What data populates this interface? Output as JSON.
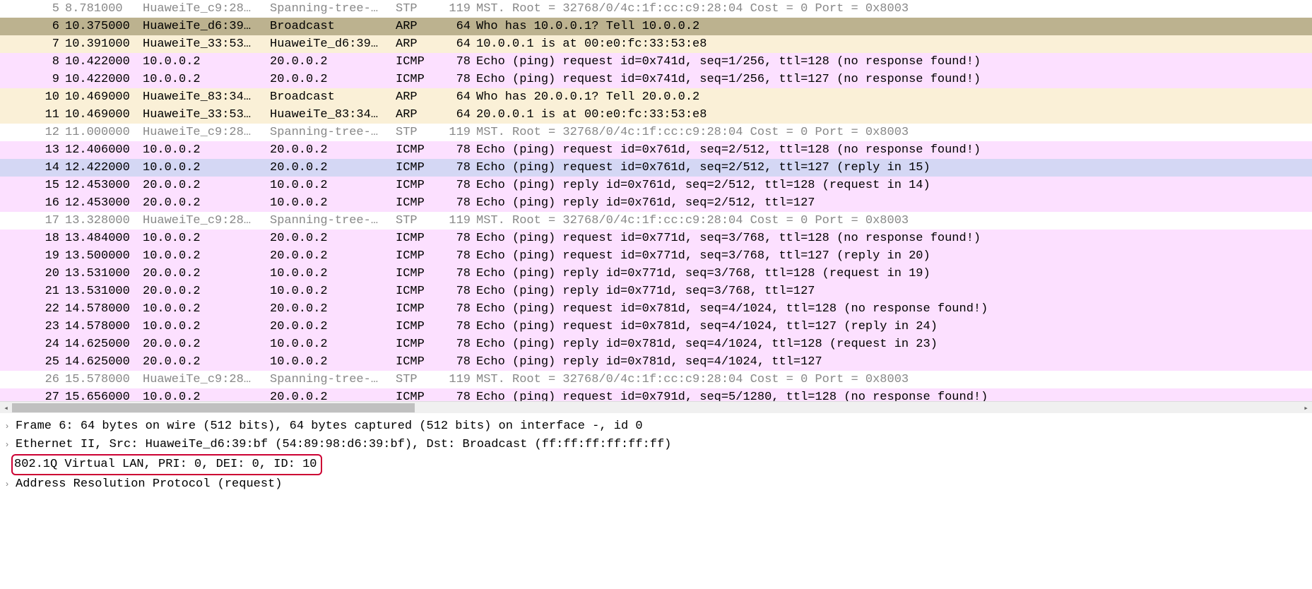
{
  "packets": [
    {
      "no": "5",
      "time": "8.781000",
      "src": "HuaweiTe_c9:28…",
      "dst": "Spanning-tree-…",
      "proto": "STP",
      "len": "119",
      "info": "MST. Root = 32768/0/4c:1f:cc:c9:28:04  Cost = 0  Port = 0x8003",
      "cls": "c-gray"
    },
    {
      "no": "6",
      "time": "10.375000",
      "src": "HuaweiTe_d6:39…",
      "dst": "Broadcast",
      "proto": "ARP",
      "len": "64",
      "info": "Who has 10.0.0.1? Tell 10.0.0.2",
      "cls": "c-selected"
    },
    {
      "no": "7",
      "time": "10.391000",
      "src": "HuaweiTe_33:53…",
      "dst": "HuaweiTe_d6:39…",
      "proto": "ARP",
      "len": "64",
      "info": "10.0.0.1 is at 00:e0:fc:33:53:e8",
      "cls": "c-arp"
    },
    {
      "no": "8",
      "time": "10.422000",
      "src": "10.0.0.2",
      "dst": "20.0.0.2",
      "proto": "ICMP",
      "len": "78",
      "info": "Echo (ping) request  id=0x741d, seq=1/256, ttl=128 (no response found!)",
      "cls": "c-icmp"
    },
    {
      "no": "9",
      "time": "10.422000",
      "src": "10.0.0.2",
      "dst": "20.0.0.2",
      "proto": "ICMP",
      "len": "78",
      "info": "Echo (ping) request  id=0x741d, seq=1/256, ttl=127 (no response found!)",
      "cls": "c-icmp"
    },
    {
      "no": "10",
      "time": "10.469000",
      "src": "HuaweiTe_83:34…",
      "dst": "Broadcast",
      "proto": "ARP",
      "len": "64",
      "info": "Who has 20.0.0.1? Tell 20.0.0.2",
      "cls": "c-arp"
    },
    {
      "no": "11",
      "time": "10.469000",
      "src": "HuaweiTe_33:53…",
      "dst": "HuaweiTe_83:34…",
      "proto": "ARP",
      "len": "64",
      "info": "20.0.0.1 is at 00:e0:fc:33:53:e8",
      "cls": "c-arp"
    },
    {
      "no": "12",
      "time": "11.000000",
      "src": "HuaweiTe_c9:28…",
      "dst": "Spanning-tree-…",
      "proto": "STP",
      "len": "119",
      "info": "MST. Root = 32768/0/4c:1f:cc:c9:28:04  Cost = 0  Port = 0x8003",
      "cls": "c-gray"
    },
    {
      "no": "13",
      "time": "12.406000",
      "src": "10.0.0.2",
      "dst": "20.0.0.2",
      "proto": "ICMP",
      "len": "78",
      "info": "Echo (ping) request  id=0x761d, seq=2/512, ttl=128 (no response found!)",
      "cls": "c-icmp"
    },
    {
      "no": "14",
      "time": "12.422000",
      "src": "10.0.0.2",
      "dst": "20.0.0.2",
      "proto": "ICMP",
      "len": "78",
      "info": "Echo (ping) request  id=0x761d, seq=2/512, ttl=127 (reply in 15)",
      "cls": "c-icmp-sel"
    },
    {
      "no": "15",
      "time": "12.453000",
      "src": "20.0.0.2",
      "dst": "10.0.0.2",
      "proto": "ICMP",
      "len": "78",
      "info": "Echo (ping) reply    id=0x761d, seq=2/512, ttl=128 (request in 14)",
      "cls": "c-icmp"
    },
    {
      "no": "16",
      "time": "12.453000",
      "src": "20.0.0.2",
      "dst": "10.0.0.2",
      "proto": "ICMP",
      "len": "78",
      "info": "Echo (ping) reply    id=0x761d, seq=2/512, ttl=127",
      "cls": "c-icmp"
    },
    {
      "no": "17",
      "time": "13.328000",
      "src": "HuaweiTe_c9:28…",
      "dst": "Spanning-tree-…",
      "proto": "STP",
      "len": "119",
      "info": "MST. Root = 32768/0/4c:1f:cc:c9:28:04  Cost = 0  Port = 0x8003",
      "cls": "c-gray"
    },
    {
      "no": "18",
      "time": "13.484000",
      "src": "10.0.0.2",
      "dst": "20.0.0.2",
      "proto": "ICMP",
      "len": "78",
      "info": "Echo (ping) request  id=0x771d, seq=3/768, ttl=128 (no response found!)",
      "cls": "c-icmp"
    },
    {
      "no": "19",
      "time": "13.500000",
      "src": "10.0.0.2",
      "dst": "20.0.0.2",
      "proto": "ICMP",
      "len": "78",
      "info": "Echo (ping) request  id=0x771d, seq=3/768, ttl=127 (reply in 20)",
      "cls": "c-icmp"
    },
    {
      "no": "20",
      "time": "13.531000",
      "src": "20.0.0.2",
      "dst": "10.0.0.2",
      "proto": "ICMP",
      "len": "78",
      "info": "Echo (ping) reply    id=0x771d, seq=3/768, ttl=128 (request in 19)",
      "cls": "c-icmp"
    },
    {
      "no": "21",
      "time": "13.531000",
      "src": "20.0.0.2",
      "dst": "10.0.0.2",
      "proto": "ICMP",
      "len": "78",
      "info": "Echo (ping) reply    id=0x771d, seq=3/768, ttl=127",
      "cls": "c-icmp"
    },
    {
      "no": "22",
      "time": "14.578000",
      "src": "10.0.0.2",
      "dst": "20.0.0.2",
      "proto": "ICMP",
      "len": "78",
      "info": "Echo (ping) request  id=0x781d, seq=4/1024, ttl=128 (no response found!)",
      "cls": "c-icmp"
    },
    {
      "no": "23",
      "time": "14.578000",
      "src": "10.0.0.2",
      "dst": "20.0.0.2",
      "proto": "ICMP",
      "len": "78",
      "info": "Echo (ping) request  id=0x781d, seq=4/1024, ttl=127 (reply in 24)",
      "cls": "c-icmp"
    },
    {
      "no": "24",
      "time": "14.625000",
      "src": "20.0.0.2",
      "dst": "10.0.0.2",
      "proto": "ICMP",
      "len": "78",
      "info": "Echo (ping) reply    id=0x781d, seq=4/1024, ttl=128 (request in 23)",
      "cls": "c-icmp"
    },
    {
      "no": "25",
      "time": "14.625000",
      "src": "20.0.0.2",
      "dst": "10.0.0.2",
      "proto": "ICMP",
      "len": "78",
      "info": "Echo (ping) reply    id=0x781d, seq=4/1024, ttl=127",
      "cls": "c-icmp"
    },
    {
      "no": "26",
      "time": "15.578000",
      "src": "HuaweiTe_c9:28…",
      "dst": "Spanning-tree-…",
      "proto": "STP",
      "len": "119",
      "info": "MST. Root = 32768/0/4c:1f:cc:c9:28:04  Cost = 0  Port = 0x8003",
      "cls": "c-gray"
    },
    {
      "no": "27",
      "time": "15.656000",
      "src": "10.0.0.2",
      "dst": "20.0.0.2",
      "proto": "ICMP",
      "len": "78",
      "info": "Echo (ping) request  id=0x791d, seq=5/1280, ttl=128 (no response found!)",
      "cls": "c-icmp"
    }
  ],
  "detail": {
    "frame": "Frame 6: 64 bytes on wire (512 bits), 64 bytes captured (512 bits) on interface -, id 0",
    "eth": "Ethernet II, Src: HuaweiTe_d6:39:bf (54:89:98:d6:39:bf), Dst: Broadcast (ff:ff:ff:ff:ff:ff)",
    "vlan": "802.1Q Virtual LAN, PRI: 0, DEI: 0, ID: 10",
    "arp": "Address Resolution Protocol (request)"
  },
  "glyphs": {
    "left_arrow": "◂",
    "right_arrow": "▸",
    "expand": "›"
  }
}
